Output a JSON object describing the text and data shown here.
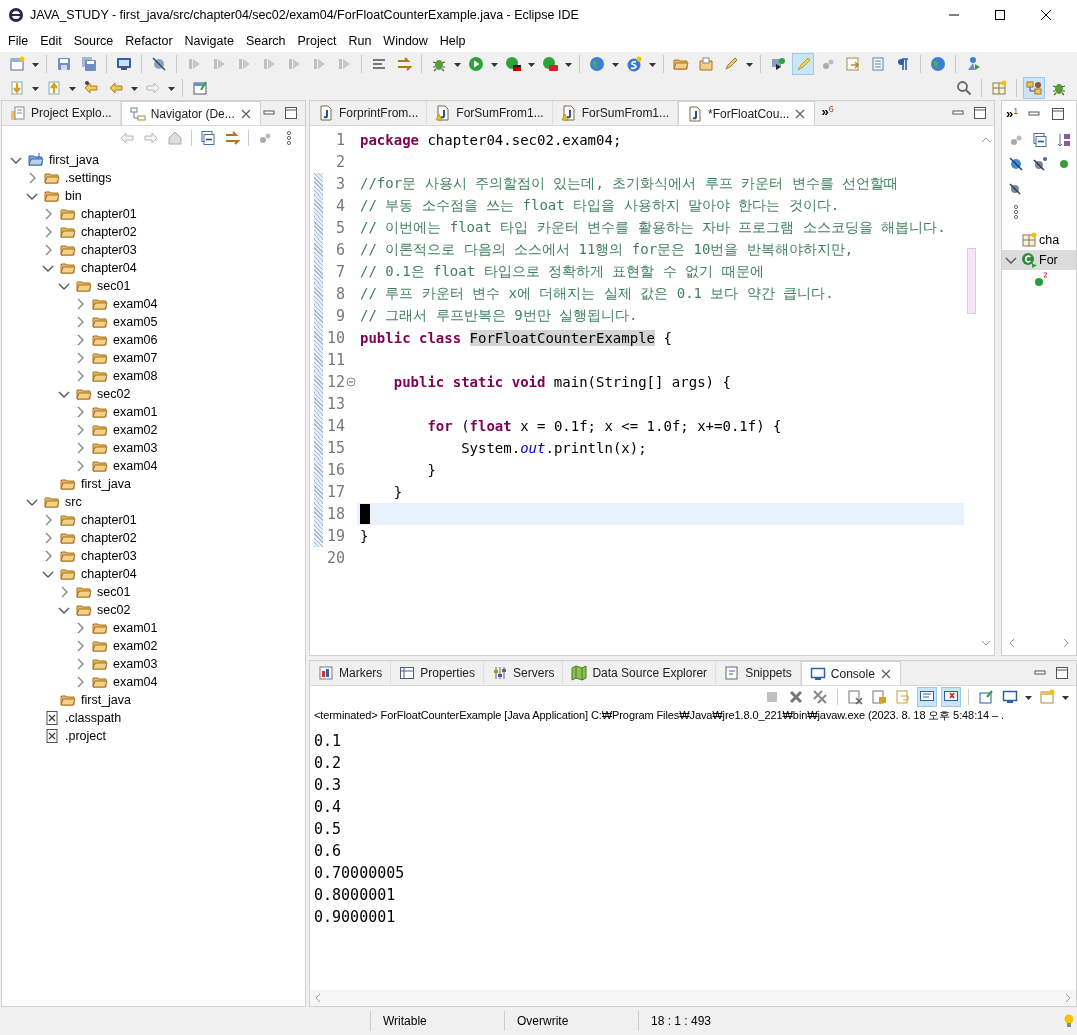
{
  "window": {
    "title": "JAVA_STUDY - first_java/src/chapter04/sec02/exam04/ForFloatCounterExample.java - Eclipse IDE"
  },
  "menu": [
    "File",
    "Edit",
    "Source",
    "Refactor",
    "Navigate",
    "Search",
    "Project",
    "Run",
    "Window",
    "Help"
  ],
  "toolbar": {
    "rows": [
      [
        {
          "kind": "menu-button",
          "pressed": false
        },
        {
          "kind": "separator"
        },
        {
          "kind": "button",
          "pressed": false
        },
        {
          "kind": "button",
          "pressed": false
        },
        {
          "kind": "separator"
        },
        {
          "kind": "button",
          "pressed": false
        },
        {
          "kind": "separator"
        },
        {
          "kind": "button",
          "pressed": false
        },
        {
          "kind": "separator"
        },
        {
          "kind": "button",
          "pressed": false
        },
        {
          "kind": "button",
          "pressed": false
        },
        {
          "kind": "button",
          "pressed": false
        },
        {
          "kind": "button",
          "pressed": false
        },
        {
          "kind": "button",
          "pressed": false
        },
        {
          "kind": "button",
          "pressed": false
        },
        {
          "kind": "button",
          "pressed": false
        },
        {
          "kind": "separator"
        },
        {
          "kind": "button",
          "pressed": false
        },
        {
          "kind": "button",
          "pressed": false
        },
        {
          "kind": "separator"
        },
        {
          "kind": "menu-button",
          "pressed": false
        },
        {
          "kind": "menu-button",
          "pressed": false
        },
        {
          "kind": "menu-button",
          "pressed": false
        },
        {
          "kind": "menu-button",
          "pressed": false
        },
        {
          "kind": "separator"
        },
        {
          "kind": "menu-button",
          "pressed": false
        },
        {
          "kind": "menu-button",
          "pressed": false
        },
        {
          "kind": "separator"
        },
        {
          "kind": "button",
          "pressed": false
        },
        {
          "kind": "button",
          "pressed": false
        },
        {
          "kind": "menu-button",
          "pressed": false
        },
        {
          "kind": "separator"
        },
        {
          "kind": "button",
          "pressed": false
        },
        {
          "kind": "button",
          "pressed": true
        },
        {
          "kind": "button",
          "pressed": false
        },
        {
          "kind": "button",
          "pressed": false
        },
        {
          "kind": "button",
          "pressed": false
        },
        {
          "kind": "button",
          "pressed": false
        },
        {
          "kind": "separator"
        },
        {
          "kind": "button",
          "pressed": false
        },
        {
          "kind": "separator"
        },
        {
          "kind": "button",
          "pressed": false
        }
      ],
      [
        {
          "kind": "menu-button",
          "pressed": false
        },
        {
          "kind": "menu-button",
          "pressed": false
        },
        {
          "kind": "button",
          "pressed": false
        },
        {
          "kind": "menu-button",
          "pressed": false
        },
        {
          "kind": "menu-button",
          "pressed": false
        },
        {
          "kind": "separator"
        },
        {
          "kind": "button",
          "pressed": false
        }
      ]
    ],
    "right": [
      {
        "kind": "button",
        "pressed": false
      },
      {
        "kind": "separator"
      },
      {
        "kind": "button",
        "pressed": false
      },
      {
        "kind": "separator"
      },
      {
        "kind": "button",
        "pressed": true
      },
      {
        "kind": "button",
        "pressed": false
      }
    ]
  },
  "explorer": {
    "tabs": [
      {
        "label": "Project Explo...",
        "selected": false
      },
      {
        "label": "Navigator (De...",
        "selected": true
      }
    ],
    "tree": [
      {
        "label": "first_java",
        "kind": "project",
        "expandable": true,
        "expanded": true,
        "children": [
          {
            "label": ".settings",
            "kind": "folder",
            "expandable": true,
            "expanded": false
          },
          {
            "label": "bin",
            "kind": "folder",
            "expandable": true,
            "expanded": true,
            "children": [
              {
                "label": "chapter01",
                "kind": "folder",
                "expandable": true,
                "expanded": false
              },
              {
                "label": "chapter02",
                "kind": "folder",
                "expandable": true,
                "expanded": false
              },
              {
                "label": "chapter03",
                "kind": "folder",
                "expandable": true,
                "expanded": false
              },
              {
                "label": "chapter04",
                "kind": "folder",
                "expandable": true,
                "expanded": true,
                "children": [
                  {
                    "label": "sec01",
                    "kind": "folder",
                    "expandable": true,
                    "expanded": true,
                    "children": [
                      {
                        "label": "exam04",
                        "kind": "folder",
                        "expandable": true,
                        "expanded": false
                      },
                      {
                        "label": "exam05",
                        "kind": "folder",
                        "expandable": true,
                        "expanded": false
                      },
                      {
                        "label": "exam06",
                        "kind": "folder",
                        "expandable": true,
                        "expanded": false
                      },
                      {
                        "label": "exam07",
                        "kind": "folder",
                        "expandable": true,
                        "expanded": false
                      },
                      {
                        "label": "exam08",
                        "kind": "folder",
                        "expandable": true,
                        "expanded": false
                      }
                    ]
                  },
                  {
                    "label": "sec02",
                    "kind": "folder",
                    "expandable": true,
                    "expanded": true,
                    "children": [
                      {
                        "label": "exam01",
                        "kind": "folder",
                        "expandable": true,
                        "expanded": false
                      },
                      {
                        "label": "exam02",
                        "kind": "folder",
                        "expandable": true,
                        "expanded": false
                      },
                      {
                        "label": "exam03",
                        "kind": "folder",
                        "expandable": true,
                        "expanded": false
                      },
                      {
                        "label": "exam04",
                        "kind": "folder",
                        "expandable": true,
                        "expanded": false
                      }
                    ]
                  }
                ]
              },
              {
                "label": "first_java",
                "kind": "folder",
                "expandable": false
              }
            ]
          },
          {
            "label": "src",
            "kind": "folder",
            "expandable": true,
            "expanded": true,
            "children": [
              {
                "label": "chapter01",
                "kind": "folder",
                "expandable": true,
                "expanded": false
              },
              {
                "label": "chapter02",
                "kind": "folder",
                "expandable": true,
                "expanded": false
              },
              {
                "label": "chapter03",
                "kind": "folder",
                "expandable": true,
                "expanded": false
              },
              {
                "label": "chapter04",
                "kind": "folder",
                "expandable": true,
                "expanded": true,
                "children": [
                  {
                    "label": "sec01",
                    "kind": "folder",
                    "expandable": true,
                    "expanded": false
                  },
                  {
                    "label": "sec02",
                    "kind": "folder",
                    "expandable": true,
                    "expanded": true,
                    "children": [
                      {
                        "label": "exam01",
                        "kind": "folder",
                        "expandable": true,
                        "expanded": false
                      },
                      {
                        "label": "exam02",
                        "kind": "folder",
                        "expandable": true,
                        "expanded": false
                      },
                      {
                        "label": "exam03",
                        "kind": "folder",
                        "expandable": true,
                        "expanded": false
                      },
                      {
                        "label": "exam04",
                        "kind": "folder",
                        "expandable": true,
                        "expanded": false
                      }
                    ]
                  }
                ]
              },
              {
                "label": "first_java",
                "kind": "folder",
                "expandable": false
              }
            ]
          },
          {
            "label": ".classpath",
            "kind": "file",
            "expandable": false
          },
          {
            "label": ".project",
            "kind": "file",
            "expandable": false
          }
        ]
      }
    ]
  },
  "editor": {
    "tabs": [
      {
        "label": "ForprintFrom...",
        "warning": false,
        "selected": false
      },
      {
        "label": "ForSumFrom1...",
        "warning": true,
        "selected": false
      },
      {
        "label": "ForSumFrom1...",
        "warning": true,
        "selected": false
      },
      {
        "label": "*ForFloatCou...",
        "warning": false,
        "selected": true
      }
    ],
    "overflow": {
      "symbol": "»",
      "count": "6"
    },
    "lines": [
      {
        "number": "1",
        "changed": false,
        "fold": false,
        "current": false,
        "tokens": [
          {
            "kind": "keyword",
            "text": "package"
          },
          {
            "kind": "plain",
            "text": " chapter04.sec02.exam04;"
          }
        ]
      },
      {
        "number": "2",
        "changed": false,
        "fold": false,
        "current": false
      },
      {
        "number": "3",
        "changed": true,
        "fold": false,
        "current": false,
        "tokens": [
          {
            "kind": "comment",
            "text": "//for문 사용시 주의할점이 있는데, 초기화식에서 루프 카운터 변수를 선언할때"
          }
        ]
      },
      {
        "number": "4",
        "changed": true,
        "fold": false,
        "current": false,
        "tokens": [
          {
            "kind": "comment",
            "text": "// 부동 소수점을 쓰는 float 타입을 사용하지 말아야 한다는 것이다."
          }
        ]
      },
      {
        "number": "5",
        "changed": true,
        "fold": false,
        "current": false,
        "tokens": [
          {
            "kind": "comment",
            "text": "// 이번에는 float 타입 카운터 변수를 활용하는 자바 프로그램 소스코딩을 해봅니다."
          }
        ]
      },
      {
        "number": "6",
        "changed": true,
        "fold": false,
        "current": false,
        "tokens": [
          {
            "kind": "comment",
            "text": "// 이론적으로 다음의 소스에서 11행의 for문은 10번을 반복해야하지만,"
          }
        ]
      },
      {
        "number": "7",
        "changed": true,
        "fold": false,
        "current": false,
        "tokens": [
          {
            "kind": "comment",
            "text": "// 0.1은 float 타입으로 정확하게 표현할 수 없기 때문에"
          }
        ]
      },
      {
        "number": "8",
        "changed": true,
        "fold": false,
        "current": false,
        "tokens": [
          {
            "kind": "comment",
            "text": "// 루프 카운터 변수 x에 더해지는 실제 값은 0.1 보다 약간 큽니다."
          }
        ]
      },
      {
        "number": "9",
        "changed": true,
        "fold": false,
        "current": false,
        "tokens": [
          {
            "kind": "comment",
            "text": "// 그래서 루프반복은 9번만 실행됩니다."
          }
        ]
      },
      {
        "number": "10",
        "changed": true,
        "fold": false,
        "current": false,
        "tokens": [
          {
            "kind": "keyword",
            "text": "public class "
          },
          {
            "kind": "occurrence",
            "text": "ForFloatCounterExample"
          },
          {
            "kind": "plain",
            "text": " {"
          }
        ]
      },
      {
        "number": "11",
        "changed": true,
        "fold": false,
        "current": false
      },
      {
        "number": "12",
        "changed": true,
        "fold": true,
        "current": false,
        "tokens": [
          {
            "kind": "keyword",
            "text": "    public static void"
          },
          {
            "kind": "plain",
            "text": " main(String[] args) {"
          }
        ]
      },
      {
        "number": "13",
        "changed": true,
        "fold": false,
        "current": false
      },
      {
        "number": "14",
        "changed": true,
        "fold": false,
        "current": false,
        "tokens": [
          {
            "kind": "keyword",
            "text": "        for"
          },
          {
            "kind": "plain",
            "text": " ("
          },
          {
            "kind": "keyword",
            "text": "float"
          },
          {
            "kind": "plain",
            "text": " x = 0.1f; x <= 1.0f; x+=0.1f) {"
          }
        ]
      },
      {
        "number": "15",
        "changed": true,
        "fold": false,
        "current": false,
        "tokens": [
          {
            "kind": "plain",
            "text": "            System."
          },
          {
            "kind": "field",
            "text": "out"
          },
          {
            "kind": "plain",
            "text": ".println(x);"
          }
        ]
      },
      {
        "number": "16",
        "changed": true,
        "fold": false,
        "current": false,
        "tokens": [
          {
            "kind": "plain",
            "text": "        }"
          }
        ]
      },
      {
        "number": "17",
        "changed": true,
        "fold": false,
        "current": false,
        "tokens": [
          {
            "kind": "plain",
            "text": "    }"
          }
        ]
      },
      {
        "number": "18",
        "changed": true,
        "fold": false,
        "current": true
      },
      {
        "number": "19",
        "changed": true,
        "fold": false,
        "current": false,
        "tokens": [
          {
            "kind": "plain",
            "text": "}"
          }
        ]
      },
      {
        "number": "20",
        "changed": false,
        "fold": false,
        "current": false
      }
    ]
  },
  "outline": {
    "overflow": {
      "symbol": "»",
      "count": "1"
    },
    "items": [
      {
        "label": "cha",
        "kind": "imports",
        "expandable": false,
        "selected": false
      },
      {
        "label": "For",
        "kind": "class",
        "expandable": true,
        "expanded": true,
        "selected": true,
        "children": [
          {
            "kind": "method",
            "expandable": false,
            "selected": false
          }
        ]
      }
    ]
  },
  "console": {
    "tabs": [
      {
        "label": "Markers",
        "selected": false
      },
      {
        "label": "Properties",
        "selected": false
      },
      {
        "label": "Servers",
        "selected": false
      },
      {
        "label": "Data Source Explorer",
        "selected": false
      },
      {
        "label": "Snippets",
        "selected": false
      },
      {
        "label": "Console",
        "selected": true
      }
    ],
    "header": "<terminated> ForFloatCounterExample [Java Application] C:₩Program Files₩Java₩jre1.8.0_221₩bin₩javaw.exe  (2023. 8. 18 오후 5:48:14 – .",
    "output": [
      "0.1",
      "0.2",
      "0.3",
      "0.4",
      "0.5",
      "0.6",
      "0.70000005",
      "0.8000001",
      "0.9000001"
    ]
  },
  "status_bar": [
    "Writable",
    "Overwrite",
    "18 : 1 : 493"
  ]
}
